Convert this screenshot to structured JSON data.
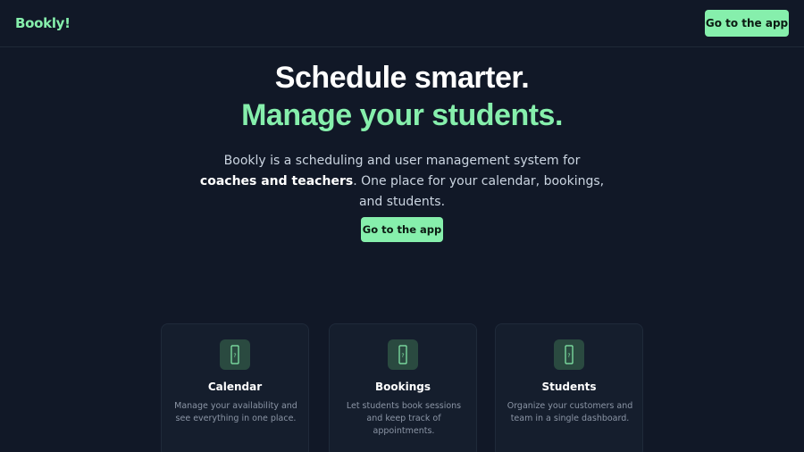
{
  "header": {
    "logo": "Bookly!",
    "cta_label": "Go to the app"
  },
  "hero": {
    "title": "Schedule smarter.",
    "subtitle": "Manage your students.",
    "desc_part1": "Bookly is a scheduling and user management system for ",
    "desc_bold": "coaches and teachers",
    "desc_part2": ". One place for your calendar, bookings, and students.",
    "cta_label": "Go to the app"
  },
  "features": [
    {
      "icon": "phone-icon",
      "title": "Calendar",
      "text": "Manage your availability and see everything in one place."
    },
    {
      "icon": "phone-icon",
      "title": "Bookings",
      "text": "Let students book sessions and keep track of appointments."
    },
    {
      "icon": "phone-icon",
      "title": "Students",
      "text": "Organize your customers and team in a single dashboard."
    }
  ],
  "colors": {
    "background": "#111827",
    "accent": "#86efac",
    "card": "#151e2d",
    "icon_bg": "#2a4a40"
  }
}
